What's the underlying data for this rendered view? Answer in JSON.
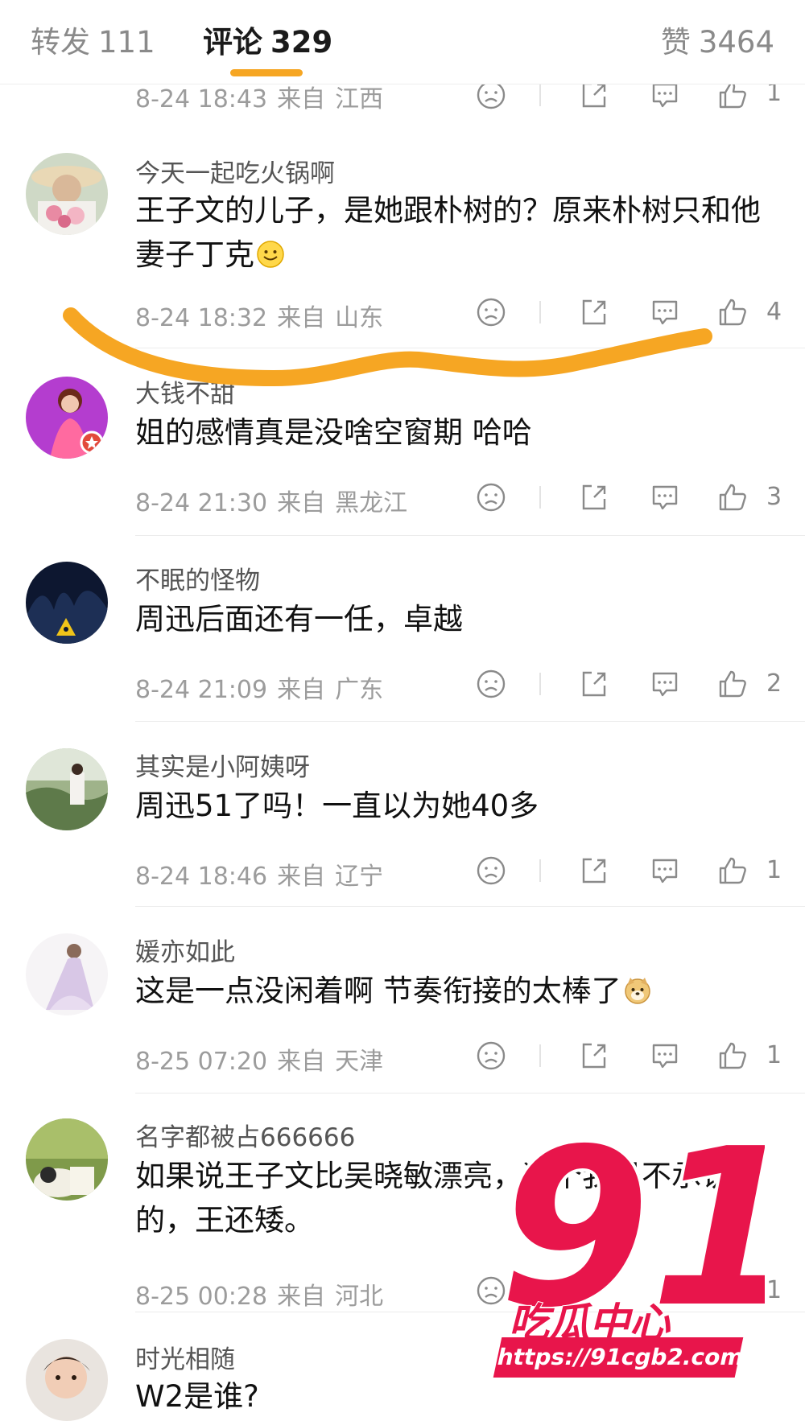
{
  "tabs": [
    {
      "label": "转发",
      "count": "111"
    },
    {
      "label": "评论",
      "count": "329"
    },
    {
      "label": "赞",
      "count": "3464"
    }
  ],
  "colors": {
    "accent": "#f6a623",
    "watermark": "#e8154b"
  },
  "partial_top": {
    "time": "8-24 18:43",
    "from": "来自",
    "location": "江西",
    "likes": "1"
  },
  "comments": [
    {
      "user": "今天一起吃火锅啊",
      "text": "王子文的儿子，是她跟朴树的？原来朴树只和他妻子丁克",
      "emoji": "smile-emoji",
      "time": "8-24 18:32",
      "from": "来自",
      "location": "山东",
      "likes": "4"
    },
    {
      "user": "大钱不甜",
      "text": "姐的感情真是没啥空窗期 哈哈",
      "time": "8-24 21:30",
      "from": "来自",
      "location": "黑龙江",
      "likes": "3"
    },
    {
      "user": "不眠的怪物",
      "text": "周迅后面还有一任，卓越",
      "time": "8-24 21:09",
      "from": "来自",
      "location": "广东",
      "likes": "2"
    },
    {
      "user": "其实是小阿姨呀",
      "text": "周迅51了吗！一直以为她40多",
      "time": "8-24 18:46",
      "from": "来自",
      "location": "辽宁",
      "likes": "1"
    },
    {
      "user": "媛亦如此",
      "text": "这是一点没闲着啊 节奏衔接的太棒了",
      "emoji": "doge-emoji",
      "time": "8-25 07:20",
      "from": "来自",
      "location": "天津",
      "likes": "1"
    },
    {
      "user": "名字都被占666666",
      "text": "如果说王子文比吴晓敏漂亮，这个我是不承认的，王还矮。",
      "time": "8-25 00:28",
      "from": "来自",
      "location": "河北",
      "likes": "1"
    },
    {
      "user": "时光相随",
      "text": "W2是谁?",
      "time": "",
      "from": "",
      "location": "",
      "likes": ""
    }
  ],
  "watermark": {
    "number": "91",
    "name": "吃瓜中心",
    "url": "https://91cgb2.com"
  }
}
